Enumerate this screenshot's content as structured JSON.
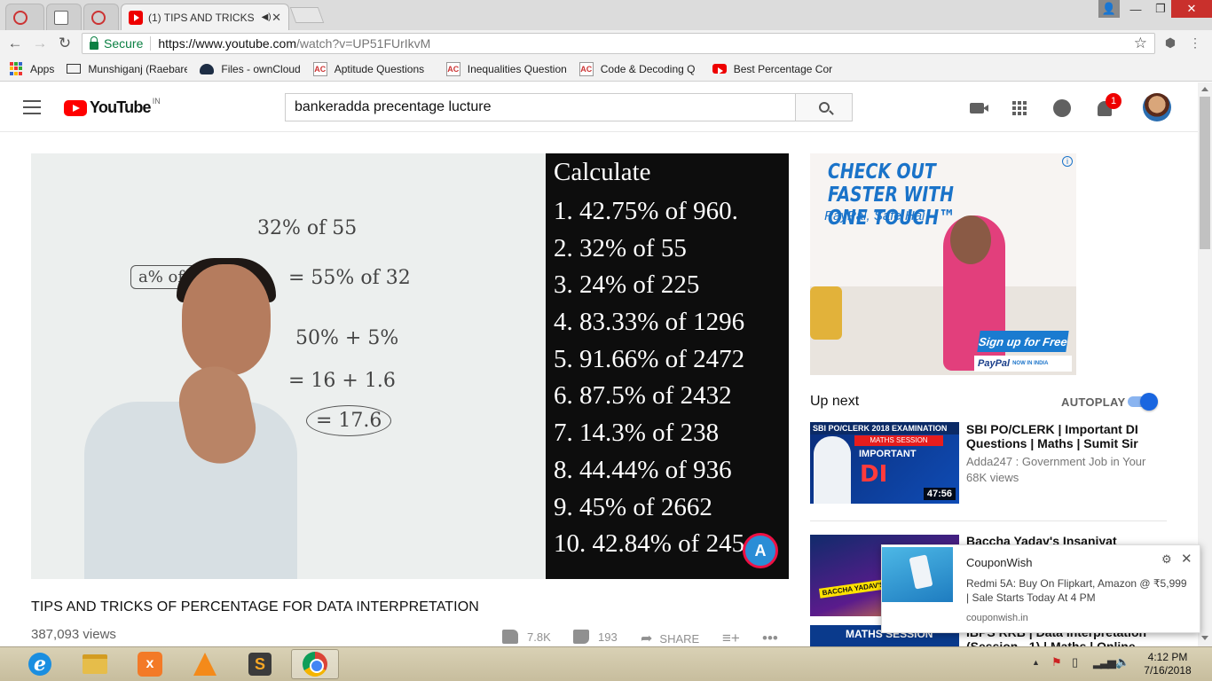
{
  "browser": {
    "tabs": [
      {
        "label": "",
        "icon": "blocked-icon"
      },
      {
        "label": "",
        "icon": "page-icon"
      },
      {
        "label": "",
        "icon": "blocked-icon"
      },
      {
        "label": "(1) TIPS AND TRICKS",
        "icon": "youtube-icon",
        "active": true
      }
    ],
    "address": {
      "secure_label": "Secure",
      "url_host": "https://www.youtube.com",
      "url_path": "/watch?v=UP51FUrIkvM"
    },
    "bookmarks": [
      {
        "label": "Apps",
        "icon": "apps-grid-icon"
      },
      {
        "label": "Munshiganj (Raebare",
        "icon": "mail-icon"
      },
      {
        "label": "Files - ownCloud",
        "icon": "cloud-icon"
      },
      {
        "label": "Aptitude Questions",
        "icon": "ac-icon"
      },
      {
        "label": "Inequalities Question",
        "icon": "ac-icon"
      },
      {
        "label": "Code & Decoding Q",
        "icon": "ac-icon"
      },
      {
        "label": "Best Percentage Cor",
        "icon": "youtube-icon"
      }
    ]
  },
  "youtube": {
    "logo_text": "YouTube",
    "region": "IN",
    "search_query": "bankeradda precentage lucture",
    "notification_count": "1"
  },
  "player": {
    "board_lines": [
      "32% of 55",
      "= 55% of 32",
      "50% + 5%",
      "= 16 + 1.6",
      "= 17.6",
      "a% of b"
    ],
    "slide_title": "Calculate",
    "slide_items": [
      "1. 42.75% of 960.",
      "2. 32% of 55",
      "3. 24% of 225",
      "4. 83.33% of 1296",
      "5. 91.66% of 2472",
      "6. 87.5% of 2432",
      "7. 14.3% of 238",
      "8. 44.44% of 936",
      "9. 45% of 2662",
      "10. 42.84% of 245"
    ],
    "slide_logo": "A"
  },
  "video": {
    "title": "TIPS AND TRICKS OF PERCENTAGE FOR DATA INTERPRETATION",
    "views": "387,093 views",
    "likes": "7.8K",
    "dislikes": "193",
    "share_label": "SHARE"
  },
  "ad": {
    "headline": "CHECK OUT FASTER WITH ONE TOUCH™",
    "sub": "PayPal, Safe Hai",
    "cta": "Sign up for Free",
    "brand": "PayPal",
    "brand_tag": "NOW IN INDIA"
  },
  "sidebar": {
    "up_next_label": "Up next",
    "autoplay_label": "AUTOPLAY",
    "autoplay_on": true,
    "recommendations": [
      {
        "title": "SBI PO/CLERK | Important DI Questions | Maths | Sumit Sir",
        "channel": "Adda247 : Government Job in Your",
        "views": "68K views",
        "duration": "47:56",
        "thumb_band": "SBI PO/CLERK 2018 EXAMINATION",
        "thumb_sub": "MATHS SESSION",
        "thumb_big": "IMPORTANT",
        "thumb_di": "DI"
      },
      {
        "title": "Baccha Yadav's Insaniyat",
        "thumb_caption": "BACCHA YADAV'S INSANIYAT CHEESE"
      },
      {
        "title": "IBPS RRB | Data Interpretation (Session - 1) | Maths | Online",
        "thumb_caption": "MATHS SESSION"
      }
    ]
  },
  "notification": {
    "source": "CouponWish",
    "message": "Redmi 5A: Buy On Flipkart, Amazon @ ₹5,999 | Sale Starts Today At 4 PM",
    "domain": "couponwish.in"
  },
  "taskbar": {
    "apps": [
      "internet-explorer",
      "file-explorer",
      "xampp",
      "vlc",
      "sublime-text",
      "chrome"
    ],
    "time": "4:12 PM",
    "date": "7/16/2018"
  }
}
